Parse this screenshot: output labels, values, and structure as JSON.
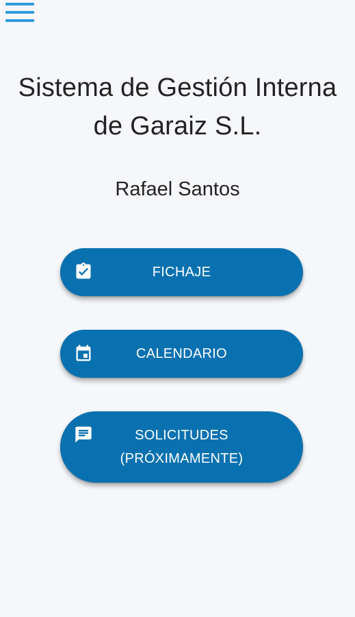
{
  "header": {
    "menu_icon": "hamburger-menu-icon"
  },
  "title": {
    "line1": "Sistema de Gestión Interna",
    "line2": "de Garaiz S.L."
  },
  "user": {
    "name": "Rafael Santos"
  },
  "buttons": {
    "fichaje": {
      "label": "FICHAJE",
      "icon": "clipboard-check-icon"
    },
    "calendario": {
      "label": "CALENDARIO",
      "icon": "calendar-icon"
    },
    "solicitudes": {
      "label_line1": "SOLICITUDES",
      "label_line2": "(PRÓXIMAMENTE)",
      "icon": "message-icon"
    }
  },
  "colors": {
    "background": "#f5f7fb",
    "button": "#0a71b0",
    "menu_accent": "#2f9bdc",
    "text": "#222222"
  }
}
